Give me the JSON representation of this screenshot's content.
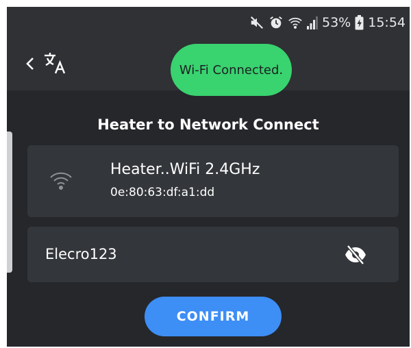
{
  "status_bar": {
    "battery_percent": "53%",
    "time": "15:54",
    "icons": [
      "mute-icon",
      "alarm-icon",
      "wifi-status-icon",
      "signal-icon",
      "battery-charging-icon"
    ]
  },
  "top_bar": {
    "back_icon": "chevron-left-icon",
    "translate_icon": "translate-icon"
  },
  "toast": {
    "message": "Wi-Fi Connected."
  },
  "page": {
    "title": "Heater to Network Connect"
  },
  "network": {
    "icon": "wifi-icon",
    "name": "Heater..WiFi 2.4GHz",
    "mac": "0e:80:63:df:a1:dd"
  },
  "password": {
    "value": "Elecro123",
    "visibility_icon": "eye-off-icon"
  },
  "confirm": {
    "label": "CONFIRM"
  },
  "colors": {
    "background": "#25272b",
    "bar": "#2f3134",
    "card": "#33363a",
    "toast": "#39d36f",
    "accent": "#3d8ef5"
  }
}
